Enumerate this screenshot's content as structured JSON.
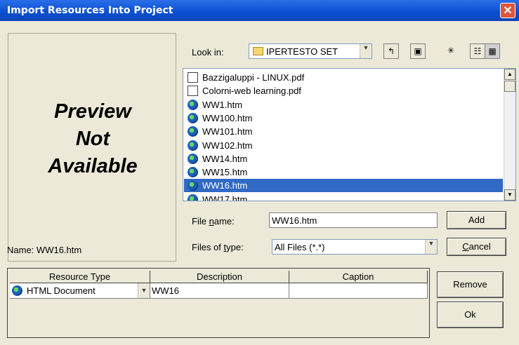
{
  "window": {
    "title": "Import Resources Into Project",
    "close_glyph": "✕"
  },
  "preview": {
    "message": "Preview\nNot\nAvailable",
    "name_label": "Name:",
    "name_value": "WW16.htm"
  },
  "look_in": {
    "label": "Look in:",
    "value": "IPERTESTO SET"
  },
  "toolbar": {
    "up_icon": "folder-up-icon",
    "desktop_icon": "desktop-icon",
    "new_folder_icon": "new-folder-icon",
    "list_icon": "list-view-icon",
    "details_icon": "details-view-icon"
  },
  "files": [
    {
      "name": "Bazzigaluppi - LINUX.pdf",
      "icon": "pdf"
    },
    {
      "name": "Colorni-web learning.pdf",
      "icon": "pdf"
    },
    {
      "name": "WW1.htm",
      "icon": "globe"
    },
    {
      "name": "WW100.htm",
      "icon": "globe"
    },
    {
      "name": "WW101.htm",
      "icon": "globe"
    },
    {
      "name": "WW102.htm",
      "icon": "globe"
    },
    {
      "name": "WW14.htm",
      "icon": "globe"
    },
    {
      "name": "WW15.htm",
      "icon": "globe"
    },
    {
      "name": "WW16.htm",
      "icon": "globe",
      "selected": true
    },
    {
      "name": "WW17.htm",
      "icon": "globe"
    }
  ],
  "file_name": {
    "label": "File name:",
    "value": "WW16.htm"
  },
  "file_type": {
    "label": "Files of type:",
    "value": "All Files (*.*)"
  },
  "buttons": {
    "add": "Add",
    "cancel": "Cancel",
    "remove": "Remove",
    "ok": "Ok"
  },
  "grid": {
    "columns": [
      "Resource Type",
      "Description",
      "Caption"
    ],
    "rows": [
      {
        "resource_type": "HTML Document",
        "description": "WW16",
        "caption": ""
      }
    ]
  },
  "colors": {
    "titlebar": "#0a4fd0",
    "selection": "#316ac5",
    "close": "#e0553a"
  }
}
